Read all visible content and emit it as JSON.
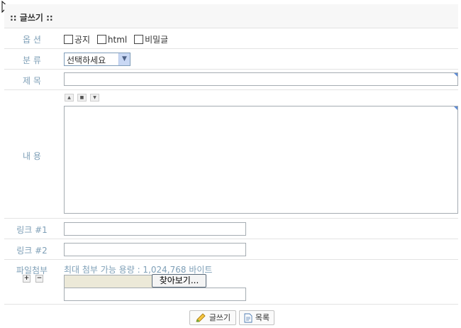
{
  "header": {
    "title": ":: 글쓰기 ::"
  },
  "options": {
    "label": "옵 션",
    "items": [
      {
        "label": "공지",
        "checked": false
      },
      {
        "label": "html",
        "checked": false
      },
      {
        "label": "비밀글",
        "checked": false
      }
    ]
  },
  "category": {
    "label": "분 류",
    "selected": "선택하세요"
  },
  "subject": {
    "label": "제 목",
    "value": ""
  },
  "content": {
    "label": "내 용",
    "value": ""
  },
  "link1": {
    "label": "링크 #1",
    "value": ""
  },
  "link2": {
    "label": "링크 #2",
    "value": ""
  },
  "file": {
    "label": "파일첨부",
    "info": "최대 첨부 가능 용량 : 1,024,768 바이트",
    "browse_label": "찾아보기...",
    "desc_value": ""
  },
  "footer": {
    "submit_label": "글쓰기",
    "list_label": "목록"
  }
}
